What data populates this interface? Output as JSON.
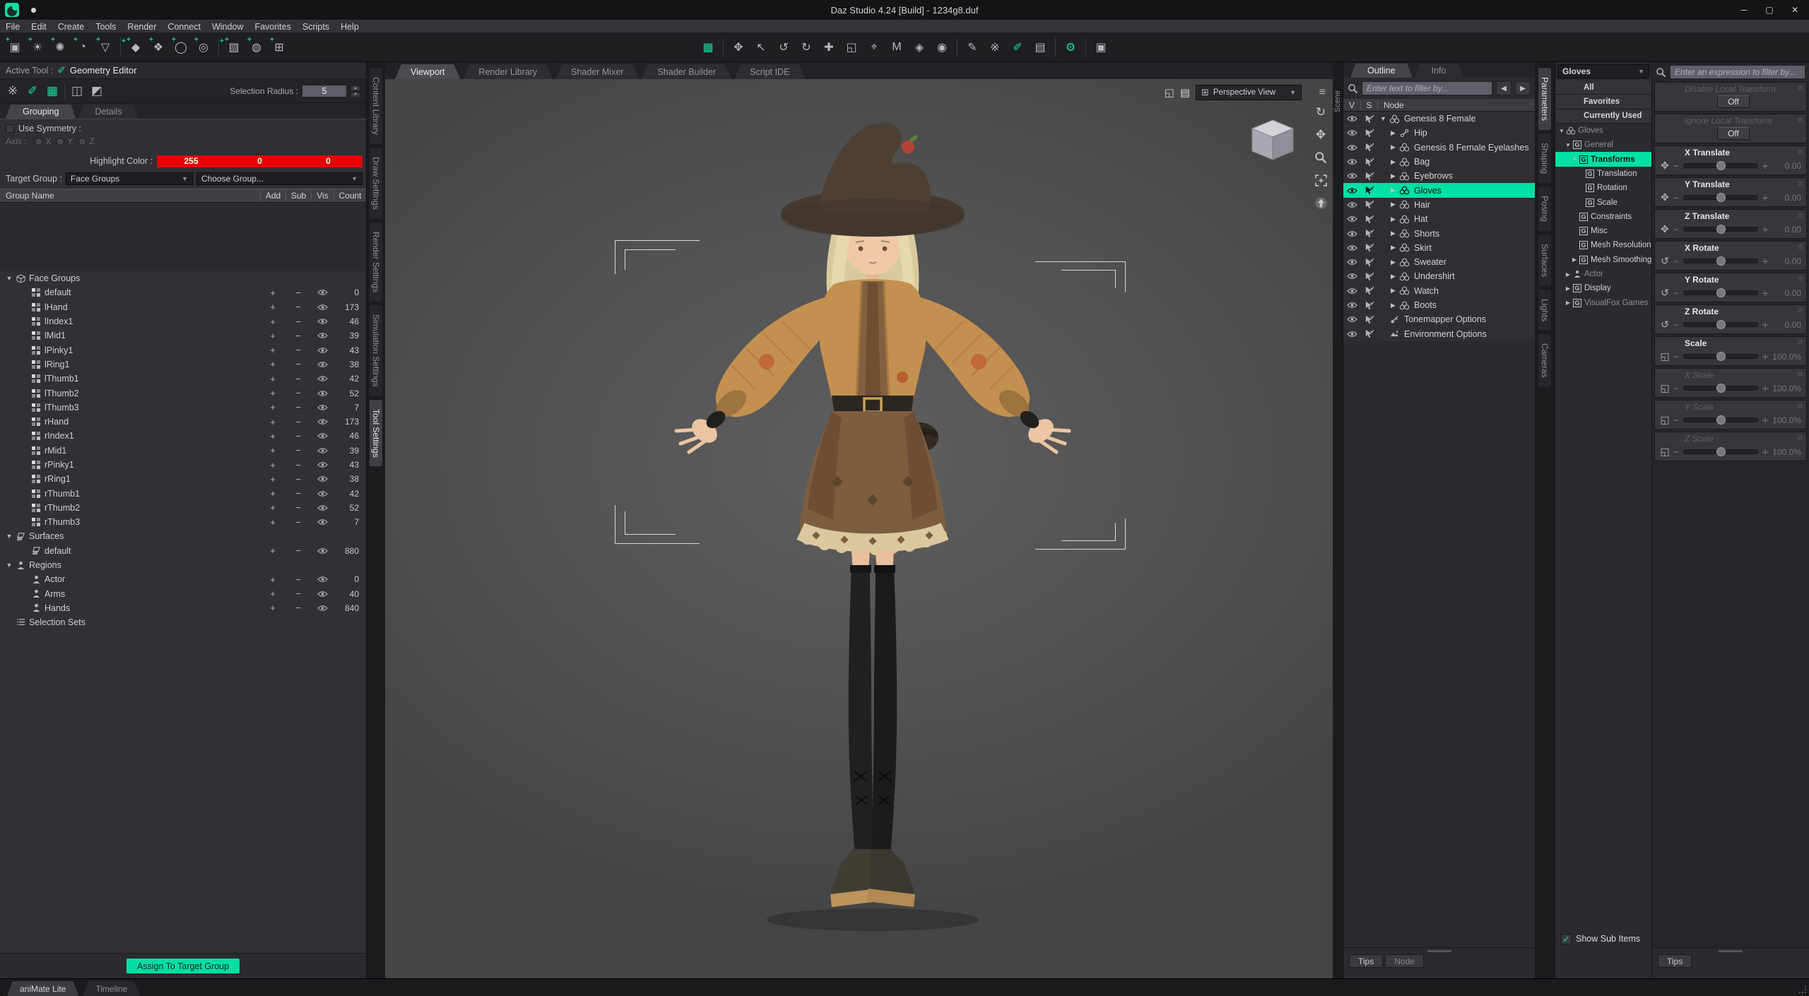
{
  "window": {
    "title": "Daz Studio 4.24 [Build] - 1234g8.duf",
    "controls": [
      {
        "name": "minimize",
        "glyph": "─"
      },
      {
        "name": "maximize",
        "glyph": "▢"
      },
      {
        "name": "close",
        "glyph": "✕"
      }
    ]
  },
  "menu": {
    "items": [
      "File",
      "Edit",
      "Create",
      "Tools",
      "Render",
      "Connect",
      "Window",
      "Favorites",
      "Scripts",
      "Help"
    ]
  },
  "toolbar": {
    "create_icons": [
      {
        "name": "create-camera-icon",
        "glyph": "▣"
      },
      {
        "name": "create-distant-light-icon",
        "glyph": "☀"
      },
      {
        "name": "create-point-light-icon",
        "glyph": "✺"
      },
      {
        "name": "create-photometric-light-icon",
        "glyph": "◔"
      },
      {
        "name": "create-spotlight-icon",
        "glyph": "▽"
      },
      {
        "sep": true
      },
      {
        "name": "create-primitive-icon",
        "glyph": "◆"
      },
      {
        "name": "create-group-node-icon",
        "glyph": "❖"
      },
      {
        "name": "create-null-node-icon",
        "glyph": "◯"
      },
      {
        "name": "create-instance-node-icon",
        "glyph": "◎"
      },
      {
        "sep": true
      },
      {
        "name": "create-cube-primitive-icon",
        "glyph": "▧"
      },
      {
        "name": "create-sphere-primitive-icon",
        "glyph": "◍"
      },
      {
        "name": "create-plane-primitive-icon",
        "glyph": "⊞"
      }
    ],
    "tool_icons": [
      {
        "name": "scene-navigator-tool-icon",
        "glyph": "▦",
        "accent": true
      },
      {
        "sep": true
      },
      {
        "name": "universal-tool-icon",
        "glyph": "✥"
      },
      {
        "name": "node-selection-tool-icon",
        "glyph": "↖"
      },
      {
        "name": "active-pose-tool-icon",
        "glyph": "↺"
      },
      {
        "name": "rotate-tool-icon",
        "glyph": "↻"
      },
      {
        "name": "translate-tool-icon",
        "glyph": "✚"
      },
      {
        "name": "scale-tool-icon",
        "glyph": "◱"
      },
      {
        "name": "joint-editor-tool-icon",
        "glyph": "⌖"
      },
      {
        "name": "surface-marquee-tool-icon",
        "glyph": "M"
      },
      {
        "name": "surface-selection-tool-icon",
        "glyph": "◈"
      },
      {
        "name": "figure-selection-tool-icon",
        "glyph": "◉"
      },
      {
        "sep": true
      },
      {
        "name": "node-editor-tool-icon",
        "glyph": "✎"
      },
      {
        "name": "brush-tool-icon",
        "glyph": "※"
      },
      {
        "name": "geometry-editor-tool-icon",
        "glyph": "✐",
        "accent": true
      },
      {
        "name": "spot-render-tool-icon",
        "glyph": "▤"
      },
      {
        "sep": true
      },
      {
        "name": "tool-options-icon",
        "glyph": "⚙",
        "accent": true
      },
      {
        "sep": true
      },
      {
        "name": "render-icon",
        "glyph": "▣"
      }
    ]
  },
  "tool_settings": {
    "active_tool_label": "Active Tool :",
    "active_tool": "Geometry Editor",
    "geo_tool_icons": [
      {
        "name": "brush-selection-tool-icon",
        "glyph": "※"
      },
      {
        "name": "geometry-edit-tool-icon",
        "glyph": "✐",
        "accent": true
      },
      {
        "name": "node-geometry-tool-icon",
        "glyph": "▦",
        "accent": true
      },
      {
        "sep": true
      },
      {
        "name": "marquee-selection-tool-icon",
        "glyph": "◫"
      },
      {
        "name": "lasso-selection-tool-icon",
        "glyph": "◩"
      }
    ],
    "selection_radius_label": "Selection Radius :",
    "selection_radius": "5",
    "tabs": [
      {
        "label": "Grouping",
        "active": true
      },
      {
        "label": "Details"
      }
    ],
    "use_symmetry_label": "Use Symmetry :",
    "axis_label": "Axis :",
    "axis_options": [
      "X",
      "Y",
      "Z"
    ],
    "highlight_color_label": "Highlight Color :",
    "highlight_values": [
      "255",
      "0",
      "0"
    ],
    "target_group_label": "Target Group :",
    "target_group_value": "Face Groups",
    "choose_group_value": "Choose Group...",
    "table_headers": {
      "name": "Group Name",
      "add": "Add",
      "sub": "Sub",
      "vis": "Vis",
      "count": "Count"
    },
    "groups": [
      {
        "label": "Face Groups",
        "depth": 0,
        "arrow": "▼",
        "icon": "cube",
        "nocontrols": true
      },
      {
        "label": "default",
        "depth": 1,
        "icon": "checker",
        "count": "0"
      },
      {
        "label": "lHand",
        "depth": 1,
        "icon": "checker",
        "count": "173"
      },
      {
        "label": "lIndex1",
        "depth": 1,
        "icon": "checker",
        "count": "46"
      },
      {
        "label": "lMid1",
        "depth": 1,
        "icon": "checker",
        "count": "39"
      },
      {
        "label": "lPinky1",
        "depth": 1,
        "icon": "checker",
        "count": "43"
      },
      {
        "label": "lRing1",
        "depth": 1,
        "icon": "checker",
        "count": "38"
      },
      {
        "label": "lThumb1",
        "depth": 1,
        "icon": "checker",
        "count": "42"
      },
      {
        "label": "lThumb2",
        "depth": 1,
        "icon": "checker",
        "count": "52"
      },
      {
        "label": "lThumb3",
        "depth": 1,
        "icon": "checker",
        "count": "7"
      },
      {
        "label": "rHand",
        "depth": 1,
        "icon": "checker",
        "count": "173"
      },
      {
        "label": "rIndex1",
        "depth": 1,
        "icon": "checker",
        "count": "46"
      },
      {
        "label": "rMid1",
        "depth": 1,
        "icon": "checker",
        "count": "39"
      },
      {
        "label": "rPinky1",
        "depth": 1,
        "icon": "checker",
        "count": "43"
      },
      {
        "label": "rRing1",
        "depth": 1,
        "icon": "checker",
        "count": "38"
      },
      {
        "label": "rThumb1",
        "depth": 1,
        "icon": "checker",
        "count": "42"
      },
      {
        "label": "rThumb2",
        "depth": 1,
        "icon": "checker",
        "count": "52"
      },
      {
        "label": "rThumb3",
        "depth": 1,
        "icon": "checker",
        "count": "7"
      },
      {
        "label": "Surfaces",
        "depth": 0,
        "arrow": "▼",
        "icon": "surface",
        "nocontrols": true
      },
      {
        "label": "default",
        "depth": 1,
        "icon": "surface",
        "count": "880"
      },
      {
        "label": "Regions",
        "depth": 0,
        "arrow": "▼",
        "icon": "person",
        "nocontrols": true
      },
      {
        "label": "Actor",
        "depth": 1,
        "icon": "person",
        "count": "0"
      },
      {
        "label": "Arms",
        "depth": 1,
        "icon": "person",
        "count": "40"
      },
      {
        "label": "Hands",
        "depth": 1,
        "icon": "person",
        "count": "840"
      },
      {
        "label": "Selection Sets",
        "depth": 0,
        "icon": "list",
        "nocontrols": true
      }
    ],
    "assign_button": "Assign To Target Group"
  },
  "left_dock_tabs": [
    {
      "label": "Content Library"
    },
    {
      "label": "Draw Settings"
    },
    {
      "label": "Render Settings"
    },
    {
      "label": "Simulation Settings"
    },
    {
      "label": "Tool Settings",
      "active": true
    }
  ],
  "viewport": {
    "tabs": [
      {
        "label": "Viewport",
        "active": true
      },
      {
        "label": "Render Library"
      },
      {
        "label": "Shader Mixer"
      },
      {
        "label": "Shader Builder"
      },
      {
        "label": "Script IDE"
      }
    ],
    "camera_selector": "Perspective View"
  },
  "scene_pane": {
    "vertical_label": "Scene",
    "tabs": [
      {
        "label": "Outline",
        "active": true
      },
      {
        "label": "Info"
      }
    ],
    "filter_placeholder": "Enter text to filter by...",
    "columns": {
      "v": "V",
      "s": "S",
      "node": "Node"
    },
    "nodes": [
      {
        "label": "Genesis 8 Female",
        "depth": 0,
        "arrow": "▼",
        "icon": "figure"
      },
      {
        "label": "Hip",
        "depth": 1,
        "arrow": "▶",
        "icon": "bone"
      },
      {
        "label": "Genesis 8 Female Eyelashes",
        "depth": 1,
        "arrow": "▶",
        "icon": "figure"
      },
      {
        "label": "Bag",
        "depth": 1,
        "arrow": "▶",
        "icon": "figure"
      },
      {
        "label": "Eyebrows",
        "depth": 1,
        "arrow": "▶",
        "icon": "figure"
      },
      {
        "label": "Gloves",
        "depth": 1,
        "arrow": "▶",
        "icon": "figure",
        "selected": true
      },
      {
        "label": "Hair",
        "depth": 1,
        "arrow": "▶",
        "icon": "figure"
      },
      {
        "label": "Hat",
        "depth": 1,
        "arrow": "▶",
        "icon": "figure"
      },
      {
        "label": "Shorts",
        "depth": 1,
        "arrow": "▶",
        "icon": "figure"
      },
      {
        "label": "Skirt",
        "depth": 1,
        "arrow": "▶",
        "icon": "figure"
      },
      {
        "label": "Sweater",
        "depth": 1,
        "arrow": "▶",
        "icon": "figure"
      },
      {
        "label": "Undershirt",
        "depth": 1,
        "arrow": "▶",
        "icon": "figure"
      },
      {
        "label": "Watch",
        "depth": 1,
        "arrow": "▶",
        "icon": "figure"
      },
      {
        "label": "Boots",
        "depth": 1,
        "arrow": "▶",
        "icon": "figure"
      },
      {
        "label": "Tonemapper Options",
        "depth": 0,
        "arrow": "",
        "icon": "wrench"
      },
      {
        "label": "Environment Options",
        "depth": 0,
        "arrow": "",
        "icon": "env"
      }
    ],
    "foot_buttons": [
      {
        "label": "Tips"
      },
      {
        "label": "Node",
        "dim": true
      }
    ]
  },
  "right_dock_tabs": [
    {
      "label": "Parameters",
      "active": true
    },
    {
      "label": "Shaping"
    },
    {
      "label": "Posing"
    },
    {
      "label": "Surfaces"
    },
    {
      "label": "Lights"
    },
    {
      "label": "Cameras"
    }
  ],
  "parameters": {
    "selector": "Gloves",
    "nav": [
      {
        "label": "All",
        "btn": true
      },
      {
        "label": "Favorites",
        "btn": true
      },
      {
        "label": "Currently Used",
        "btn": true
      },
      {
        "label": "Gloves",
        "depth": 0,
        "arrow": "▼",
        "icon": "figure",
        "dim": true
      },
      {
        "label": "General",
        "depth": 1,
        "arrow": "▼",
        "icon": "G",
        "dim": true
      },
      {
        "label": "Transforms",
        "depth": 2,
        "arrow": "▼",
        "icon": "G",
        "selected": true
      },
      {
        "label": "Translation",
        "depth": 3,
        "arrow": "",
        "icon": "G"
      },
      {
        "label": "Rotation",
        "depth": 3,
        "arrow": "",
        "icon": "G"
      },
      {
        "label": "Scale",
        "depth": 3,
        "arrow": "",
        "icon": "G"
      },
      {
        "label": "Constraints",
        "depth": 2,
        "arrow": "",
        "icon": "G"
      },
      {
        "label": "Misc",
        "depth": 2,
        "arrow": "",
        "icon": "G"
      },
      {
        "label": "Mesh Resolution",
        "depth": 2,
        "arrow": "",
        "icon": "G"
      },
      {
        "label": "Mesh Smoothing",
        "depth": 2,
        "arrow": "▶",
        "icon": "G"
      },
      {
        "label": "Actor",
        "depth": 1,
        "arrow": "▶",
        "icon": "person",
        "dim": true
      },
      {
        "label": "Display",
        "depth": 1,
        "arrow": "▶",
        "icon": "G"
      },
      {
        "label": "VisualFox Games",
        "depth": 1,
        "arrow": "▶",
        "icon": "G",
        "dim": true
      }
    ],
    "filter_placeholder": "Enter an expression to filter by...",
    "toggles": [
      {
        "label": "Disable Local Transform",
        "value": "Off"
      },
      {
        "label": "Ignore Local Transform",
        "value": "Off"
      }
    ],
    "sliders": [
      {
        "label": "X Translate",
        "value": "0.00",
        "glyph": "✥"
      },
      {
        "label": "Y Translate",
        "value": "0.00",
        "glyph": "✥"
      },
      {
        "label": "Z Translate",
        "value": "0.00",
        "glyph": "✥"
      },
      {
        "label": "X Rotate",
        "value": "0.00",
        "glyph": "↺"
      },
      {
        "label": "Y Rotate",
        "value": "0.00",
        "glyph": "↺"
      },
      {
        "label": "Z Rotate",
        "value": "0.00",
        "glyph": "↺"
      },
      {
        "label": "Scale",
        "value": "100.0%",
        "glyph": "◱"
      },
      {
        "label": "X Scale",
        "value": "100.0%",
        "glyph": "◱",
        "dim": true
      },
      {
        "label": "Y Scale",
        "value": "100.0%",
        "glyph": "◱",
        "dim": true
      },
      {
        "label": "Z Scale",
        "value": "100.0%",
        "glyph": "◱",
        "dim": true
      }
    ],
    "show_sub_items_label": "Show Sub Items",
    "foot_buttons": [
      {
        "label": "Tips"
      }
    ]
  },
  "bottom_bar": {
    "tabs": [
      {
        "label": "aniMate Lite",
        "active": true
      },
      {
        "label": "Timeline"
      }
    ]
  },
  "colors": {
    "accent": "#00dfa4",
    "highlight_red": "#e60000"
  }
}
